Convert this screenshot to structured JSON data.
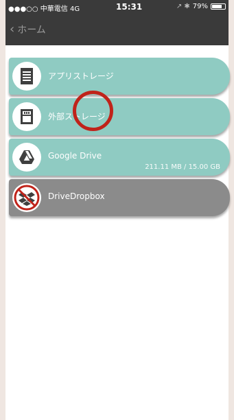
{
  "status_bar": {
    "carrier": "●●●○○ 中華電信  4G",
    "time": "15:31",
    "icons": "↗ ✱",
    "battery_percent": "79%",
    "battery_level": 0.79
  },
  "nav": {
    "back_label": "ホーム",
    "back_icon": "chevron-left-icon"
  },
  "colors": {
    "teal": "#8fcbc2",
    "gray": "#8b8b8b",
    "bar": "#3a3a3a",
    "annotation": "#c0231a"
  },
  "storage_items": [
    {
      "label": "アプリストレージ",
      "icon": "document-icon",
      "sub": ""
    },
    {
      "label": "外部ストレージ",
      "icon": "sd-card-icon",
      "sub": ""
    },
    {
      "label": "Google Drive",
      "icon": "google-drive-icon",
      "sub": "211.11 MB / 15.00 GB"
    },
    {
      "label": "DriveDropbox",
      "icon": "dropbox-disabled-icon",
      "sub": ""
    }
  ]
}
